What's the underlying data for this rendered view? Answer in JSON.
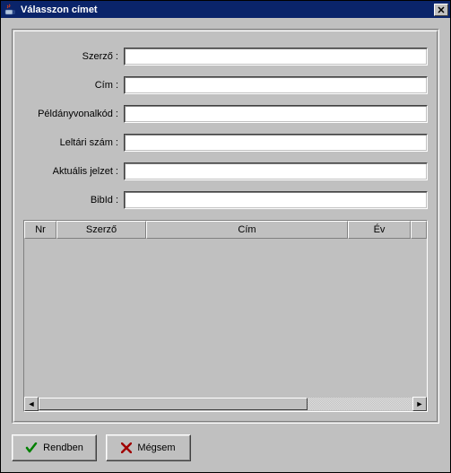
{
  "titlebar": {
    "title": "Válasszon címet"
  },
  "form": {
    "author_label": "Szerző :",
    "title_label": "Cím :",
    "barcode_label": "Példányvonalkód :",
    "inventory_label": "Leltári szám :",
    "callnum_label": "Aktuális jelzet :",
    "bibid_label": "BibId :",
    "author_value": "",
    "title_value": "",
    "barcode_value": "",
    "inventory_value": "",
    "callnum_value": "",
    "bibid_value": ""
  },
  "grid": {
    "columns": {
      "nr": "Nr",
      "author": "Szerző",
      "title": "Cím",
      "year": "Év"
    },
    "rows": []
  },
  "buttons": {
    "ok": "Rendben",
    "cancel": "Mégsem"
  },
  "icons": {
    "app": "java-cup-icon",
    "close": "close-icon",
    "check": "check-icon",
    "x": "x-icon",
    "left": "◄",
    "right": "►"
  }
}
